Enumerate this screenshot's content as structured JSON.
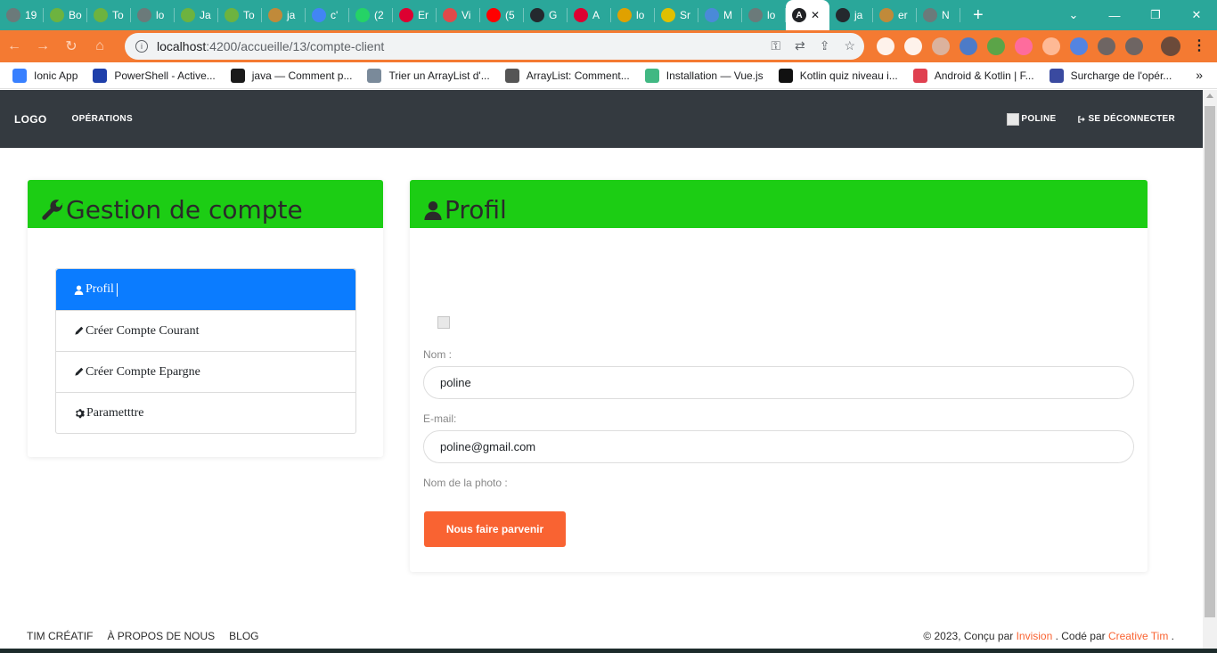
{
  "browser": {
    "tabs": [
      {
        "label": "19",
        "color": "#6b7a7a"
      },
      {
        "label": "Bo",
        "color": "#6db33f"
      },
      {
        "label": "To",
        "color": "#6db33f"
      },
      {
        "label": "lo",
        "color": "#6b7a7a"
      },
      {
        "label": "Ja",
        "color": "#6db33f"
      },
      {
        "label": "To",
        "color": "#6db33f"
      },
      {
        "label": "ja",
        "color": "#c08a3a"
      },
      {
        "label": "c'",
        "color": "#4285f4"
      },
      {
        "label": "(2",
        "color": "#25d366"
      },
      {
        "label": "Er",
        "color": "#dd0031"
      },
      {
        "label": "Vi",
        "color": "#e04a4a"
      },
      {
        "label": "(5",
        "color": "#ff0000"
      },
      {
        "label": "G",
        "color": "#24292e"
      },
      {
        "label": "A",
        "color": "#dd0031"
      },
      {
        "label": "lo",
        "color": "#e0a100"
      },
      {
        "label": "Sr",
        "color": "#e0c000"
      },
      {
        "label": "M",
        "color": "#4a8ad8"
      },
      {
        "label": "lo",
        "color": "#6b7a7a"
      }
    ],
    "active_tab": {
      "label": "",
      "close": "✕"
    },
    "tabs_after": [
      {
        "label": "ja",
        "color": "#24292e"
      },
      {
        "label": "er",
        "color": "#c08a3a"
      },
      {
        "label": "N",
        "color": "#6b7a7a"
      }
    ],
    "new_tab": "+",
    "window_controls": [
      "⌄",
      "—",
      "❐",
      "✕"
    ],
    "url_host": "localhost",
    "url_path": ":4200/accueille/13/compte-client",
    "bookmarks": [
      {
        "label": "Ionic App",
        "color": "#3880ff"
      },
      {
        "label": "PowerShell - Active...",
        "color": "#1e3faa"
      },
      {
        "label": "java — Comment p...",
        "color": "#1a1a1a"
      },
      {
        "label": "Trier un ArrayList d'...",
        "color": "#7a8a9a"
      },
      {
        "label": "ArrayList: Comment...",
        "color": "#555555"
      },
      {
        "label": "Installation — Vue.js",
        "color": "#41b883"
      },
      {
        "label": "Kotlin quiz niveau i...",
        "color": "#111111"
      },
      {
        "label": "Android & Kotlin | F...",
        "color": "#e04050"
      },
      {
        "label": "Surcharge de l'opér...",
        "color": "#3a4aa0"
      }
    ],
    "bookmarks_more": "»"
  },
  "navbar": {
    "brand": "LOGO",
    "operations": "OPÉRATIONS",
    "user": "POLINE",
    "logout": "SE DÉCONNECTER"
  },
  "account_card": {
    "title": "Gestion de compte",
    "menu": [
      {
        "label": "Profil",
        "active": true
      },
      {
        "label": "Créer Compte Courant",
        "active": false
      },
      {
        "label": "Créer Compte Epargne",
        "active": false
      },
      {
        "label": "Parametttre",
        "active": false
      }
    ]
  },
  "profile_card": {
    "title": "Profil",
    "name_label": "Nom :",
    "name_value": "poline",
    "email_label": "E-mail:",
    "email_value": "poline@gmail.com",
    "photo_label": "Nom de la photo :",
    "submit_label": "Nous faire parvenir"
  },
  "footer": {
    "links": [
      "TIM CRÉATIF",
      "À PROPOS DE NOUS",
      "BLOG"
    ],
    "copyright_prefix": "© 2023, Conçu par ",
    "designer": "Invision",
    "coded_by_text": " . Codé par ",
    "coder": "Creative Tim",
    "suffix": " ."
  },
  "colors": {
    "header_green": "#1ccd14",
    "active_blue": "#0b7cff",
    "accent_orange": "#f96332",
    "navbar_dark": "#343a40",
    "browser_teal": "#2aa79a",
    "toolbar_orange": "#f47a32"
  }
}
